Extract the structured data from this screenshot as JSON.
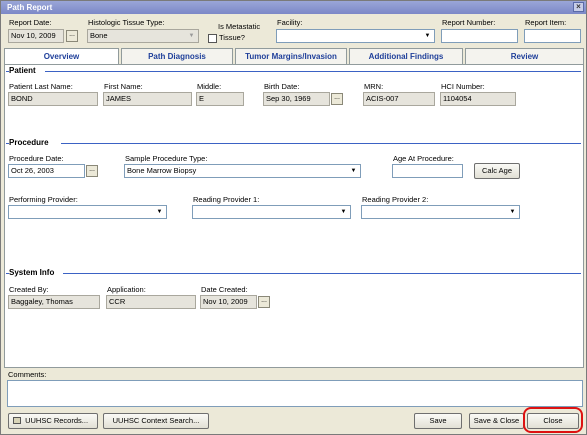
{
  "window": {
    "title": "Path Report",
    "close_glyph": "×"
  },
  "header": {
    "report_date_label": "Report Date:",
    "report_date_value": "Nov 10, 2009",
    "tissue_type_label": "Histologic Tissue Type:",
    "tissue_type_value": "Bone",
    "metastatic_label_1": "Is Metastatic",
    "metastatic_label_2": "Tissue?",
    "facility_label": "Facility:",
    "facility_value": "",
    "report_number_label": "Report Number:",
    "report_number_value": "",
    "report_item_label": "Report Item:",
    "report_item_value": ""
  },
  "tabs": [
    {
      "label": "Overview"
    },
    {
      "label": "Path Diagnosis"
    },
    {
      "label": "Tumor Margins/Invasion"
    },
    {
      "label": "Additional Findings"
    },
    {
      "label": "Review"
    }
  ],
  "patient": {
    "section_title": "Patient",
    "last_name_label": "Patient Last Name:",
    "last_name_value": "BOND",
    "first_name_label": "First Name:",
    "first_name_value": "JAMES",
    "middle_label": "Middle:",
    "middle_value": "E",
    "birth_date_label": "Birth Date:",
    "birth_date_value": "Sep 30, 1969",
    "mrn_label": "MRN:",
    "mrn_value": "ACIS-007",
    "hci_label": "HCI Number:",
    "hci_value": "1104054"
  },
  "procedure": {
    "section_title": "Procedure",
    "date_label": "Procedure Date:",
    "date_value": "Oct 26, 2003",
    "sample_type_label": "Sample Procedure Type:",
    "sample_type_value": "Bone Marrow Biopsy",
    "age_label": "Age At Procedure:",
    "age_value": "",
    "calc_age_button": "Calc Age",
    "performing_label": "Performing Provider:",
    "reading1_label": "Reading Provider 1:",
    "reading2_label": "Reading Provider 2:"
  },
  "system": {
    "section_title": "System Info",
    "created_by_label": "Created By:",
    "created_by_value": "Baggaley, Thomas",
    "application_label": "Application:",
    "application_value": "CCR",
    "date_created_label": "Date Created:",
    "date_created_value": "Nov 10, 2009"
  },
  "comments": {
    "label": "Comments:",
    "value": ""
  },
  "footer": {
    "records_button": "UUHSC Records...",
    "context_button": "UUHSC Context Search...",
    "save_button": "Save",
    "save_close_button": "Save & Close",
    "close_button": "Close"
  },
  "icons": {
    "dropdown_arrow": "▼",
    "ellipsis": "..."
  }
}
